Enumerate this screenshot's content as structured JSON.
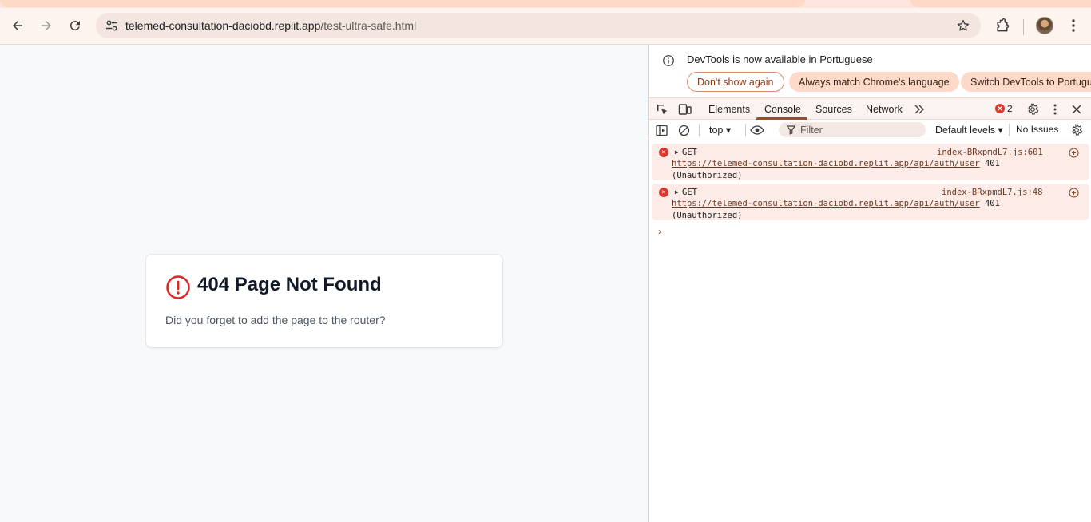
{
  "browser": {
    "url_host": "telemed-consultation-daciobd.replit.app",
    "url_path": "/test-ultra-safe.html",
    "icons": [
      "back-arrow-icon",
      "forward-arrow-icon",
      "reload-icon",
      "site-settings-icon",
      "bookmark-star-icon",
      "extensions-puzzle-icon",
      "profile-avatar",
      "kebab-menu-icon"
    ]
  },
  "page": {
    "title": "404 Page Not Found",
    "description": "Did you forget to add the page to the router?",
    "accent_color": "#dc2626"
  },
  "devtools": {
    "infobar": {
      "message": "DevTools is now available in Portuguese",
      "dont_show": "Don't show again",
      "always_match": "Always match Chrome's language",
      "switch": "Switch DevTools to Portuguese"
    },
    "tabs": [
      "Elements",
      "Console",
      "Sources",
      "Network"
    ],
    "active_tab": "Console",
    "error_count": "2",
    "context": "top",
    "filter_placeholder": "Filter",
    "levels": "Default levels",
    "issues": "No Issues",
    "logs": [
      {
        "method": "GET",
        "source": "index-BRxpmdL7.js:601",
        "url": "https://telemed-consultation-daciobd.replit.app/api/auth/user",
        "status": "401",
        "status_text": "(Unauthorized)"
      },
      {
        "method": "GET",
        "source": "index-BRxpmdL7.js:48",
        "url": "https://telemed-consultation-daciobd.replit.app/api/auth/user",
        "status": "401",
        "status_text": "(Unauthorized)"
      }
    ],
    "prompt": "›"
  }
}
